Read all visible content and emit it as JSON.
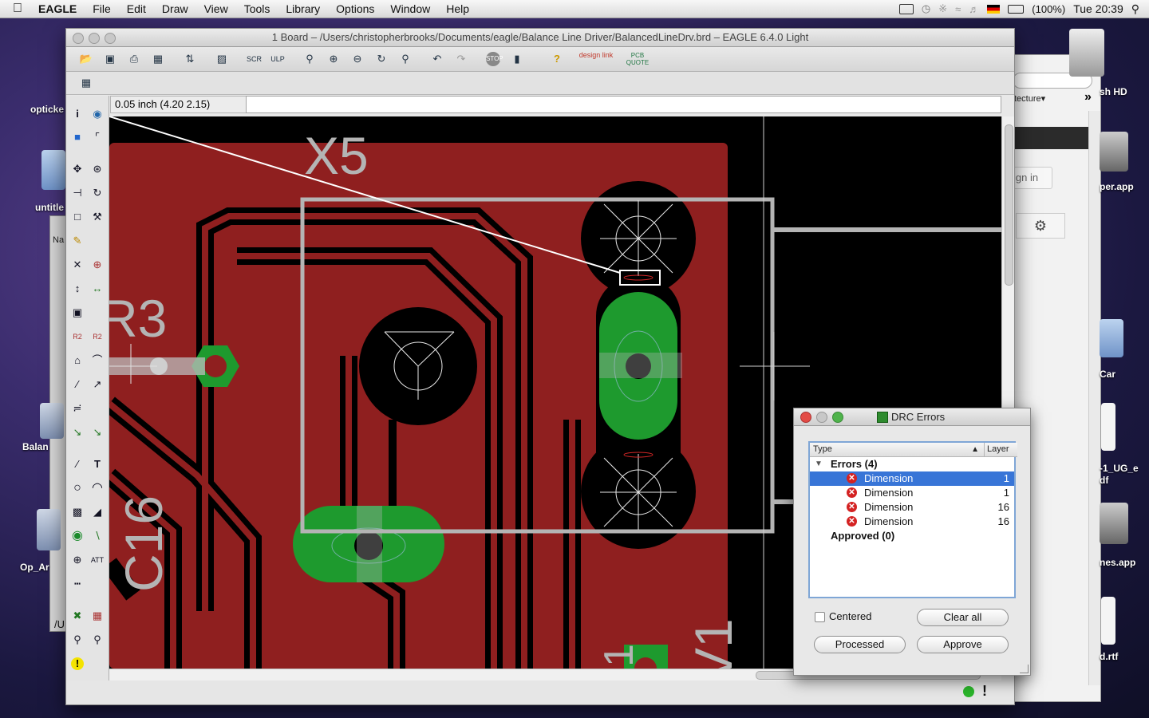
{
  "menubar": {
    "app": "EAGLE",
    "items": [
      "File",
      "Edit",
      "Draw",
      "View",
      "Tools",
      "Library",
      "Options",
      "Window",
      "Help"
    ],
    "battery": "(100%)",
    "clock": "Tue 20:39"
  },
  "desktop": {
    "labels": [
      "opticke",
      "untitle",
      "Balan",
      "Op_Ar",
      "/U",
      "sh HD",
      "per.app",
      "Car",
      "-1_UG_e",
      "df",
      "nes.app",
      "d.rtf"
    ],
    "browser": {
      "tab": "tecture▾",
      "signin": "ign in"
    }
  },
  "window": {
    "title": "1 Board – /Users/christopherbrooks/Documents/eagle/Balance Line Driver/BalancedLineDrv.brd – EAGLE 6.4.0 Light",
    "coord": "0.05 inch (4.20 2.15)",
    "command": "",
    "toolbar_logos": {
      "designlink": "design link",
      "pcbquote": "PCB QUOTE"
    }
  },
  "board": {
    "labels": {
      "x5": "X5",
      "r3": "R3",
      "c16": "C16",
      "v1": "V1",
      "one": "1"
    },
    "colors": {
      "copper": "#8f1f1f",
      "pad": "#1e9a2e",
      "outline": "#b4b4b4"
    }
  },
  "drc": {
    "title": "DRC Errors",
    "col_type": "Type",
    "col_layer": "Layer",
    "errors_group": "Errors (4)",
    "errors": [
      {
        "type": "Dimension",
        "layer": "1"
      },
      {
        "type": "Dimension",
        "layer": "1"
      },
      {
        "type": "Dimension",
        "layer": "16"
      },
      {
        "type": "Dimension",
        "layer": "16"
      }
    ],
    "approved_group": "Approved (0)",
    "centered": "Centered",
    "clear_all": "Clear all",
    "processed": "Processed",
    "approve": "Approve"
  },
  "status": {
    "exclaim": "!"
  }
}
